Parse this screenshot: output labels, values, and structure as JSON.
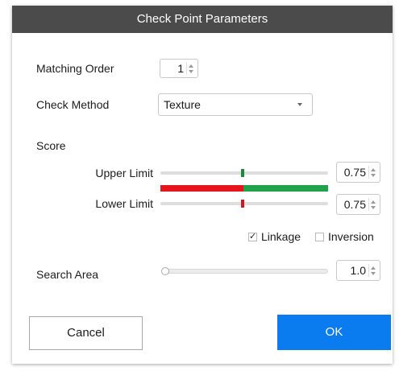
{
  "dialog": {
    "title": "Check Point Parameters",
    "matching_order": {
      "label": "Matching Order",
      "value": "1"
    },
    "check_method": {
      "label": "Check Method",
      "value": "Texture"
    },
    "score": {
      "label": "Score",
      "upper_limit": {
        "label": "Upper Limit",
        "value": "0.75",
        "level": 0.5
      },
      "lower_limit": {
        "label": "Lower Limit",
        "value": "0.75",
        "level": 0.5
      },
      "range_colors": {
        "low": "#e8141c",
        "high": "#1fa34a"
      },
      "upper_thumb_color": "#1b8a3a",
      "lower_thumb_color": "#d8151c"
    },
    "options": {
      "linkage": {
        "label": "Linkage",
        "checked": true
      },
      "inversion": {
        "label": "Inversion",
        "checked": false
      }
    },
    "search_area": {
      "label": "Search Area",
      "value": "1.0",
      "level": 0.0
    },
    "buttons": {
      "cancel": "Cancel",
      "ok": "OK"
    },
    "colors": {
      "title_bg": "#4b4b4b",
      "ok_bg": "#0a7cf0"
    }
  }
}
